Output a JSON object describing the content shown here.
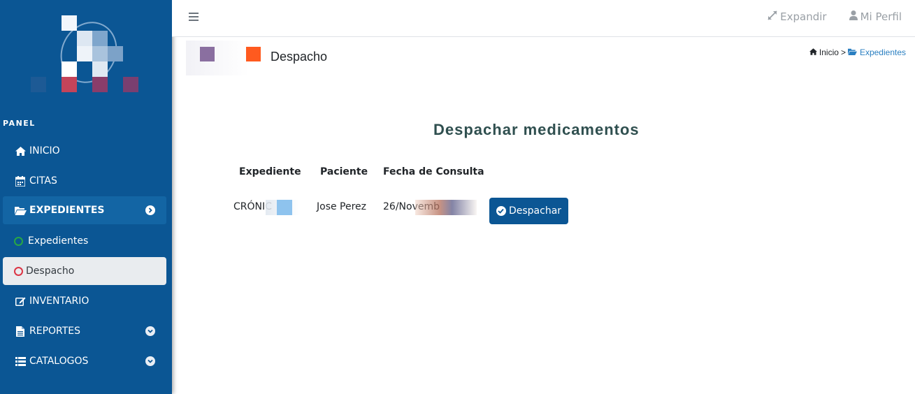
{
  "sidebar": {
    "panel_label": "PANEL",
    "items": [
      {
        "label": "INICIO",
        "icon": "home-icon"
      },
      {
        "label": "CITAS",
        "icon": "calendar-icon"
      },
      {
        "label": "EXPEDIENTES",
        "icon": "folder-open-icon"
      },
      {
        "label": "Expedientes",
        "icon": "circle-icon"
      },
      {
        "label": "Despacho",
        "icon": "circle-icon"
      },
      {
        "label": "INVENTARIO",
        "icon": "edit-icon"
      },
      {
        "label": "REPORTES",
        "icon": "file-icon"
      },
      {
        "label": "CATALOGOS",
        "icon": "list-icon"
      }
    ]
  },
  "topbar": {
    "expand_label": "Expandir",
    "profile_label": "Mi Perfil"
  },
  "header": {
    "title": "Despacho",
    "breadcrumb": {
      "home": "Inicio",
      "separator": ">",
      "current": "Expedientes"
    }
  },
  "main": {
    "title": "Despachar medicamentos",
    "table": {
      "headers": [
        "Expediente",
        "Paciente",
        "Fecha de Consulta"
      ],
      "rows": [
        {
          "expediente": "CRÓNIC",
          "paciente": "Jose Perez",
          "fecha": "26/Novemb",
          "action": "Despachar"
        }
      ]
    }
  },
  "colors": {
    "sidebar_bg": "#0b5694",
    "accent": "#0b5694",
    "active_item": "#1365a4",
    "link": "#2a7fc1",
    "circle_green": "#28a745",
    "circle_red": "#dc3545"
  }
}
